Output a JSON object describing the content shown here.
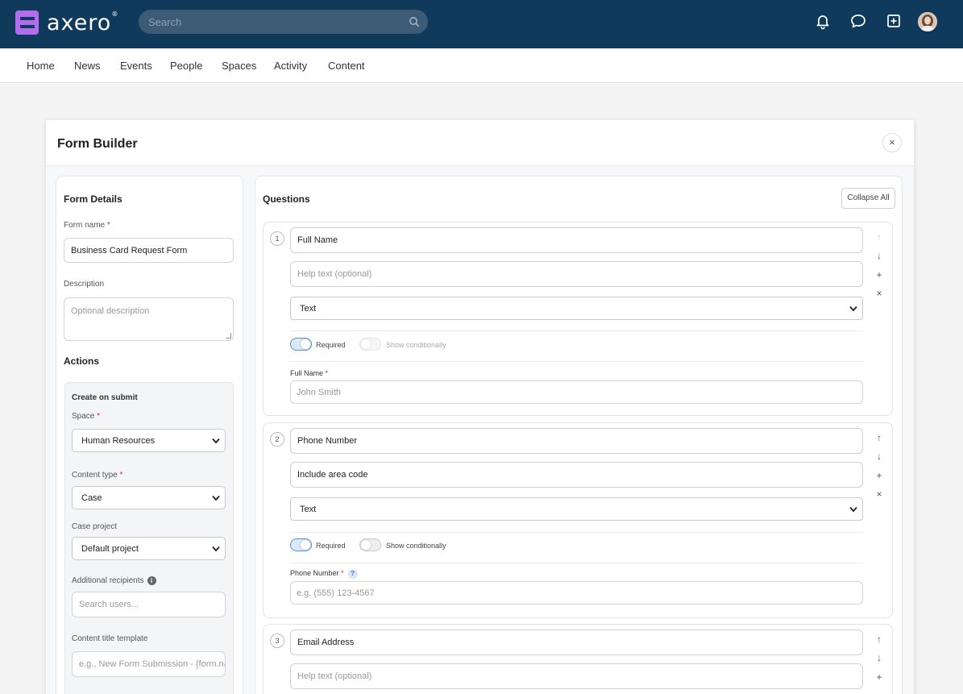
{
  "app": {
    "logo_text": "axero",
    "logo_mark": "®",
    "search_placeholder": "Search"
  },
  "nav": [
    "Home",
    "News",
    "Events",
    "People",
    "Spaces",
    "Activity",
    "Content"
  ],
  "panel": {
    "title": "Form Builder",
    "close_label": "×"
  },
  "form_details": {
    "title": "Form Details",
    "name_label": "Form name",
    "name_required": "*",
    "name_value": "Business Card Request Form",
    "description_label": "Description",
    "description_placeholder": "Optional description"
  },
  "actions": {
    "title": "Actions",
    "create_label": "Create on submit",
    "space_label": "Space",
    "space_value": "Human Resources",
    "content_type_label": "Content type",
    "content_type_value": "Case",
    "case_project_label": "Case project",
    "case_project_value": "Default project",
    "recipients_label": "Additional recipients",
    "recipients_placeholder": "Search users...",
    "title_template_label": "Content title template",
    "title_template_placeholder": "e.g., New Form Submission - {form.na"
  },
  "questions": {
    "title": "Questions",
    "collapse_label": "Collapse All",
    "items": [
      {
        "num": "1",
        "name": "Full Name",
        "help": "Help text (optional)",
        "help_is_placeholder": true,
        "type": "Text",
        "required_label": "Required",
        "conditional_label": "Show conditionally",
        "preview_label": "Full Name",
        "preview_placeholder": "John Smith"
      },
      {
        "num": "2",
        "name": "Phone Number",
        "help": "Include area code",
        "help_is_placeholder": false,
        "type": "Text",
        "required_label": "Required",
        "conditional_label": "Show conditionally",
        "preview_label": "Phone Number",
        "preview_placeholder": "e.g. (555) 123-4567",
        "help_badge": "?"
      },
      {
        "num": "3",
        "name": "Email Address",
        "help": "Help text (optional)",
        "help_is_placeholder": true
      }
    ],
    "side_glyphs": {
      "up": "↑",
      "down": "↓",
      "add": "+",
      "remove": "×"
    }
  },
  "required_mark": "*",
  "info_glyph": "i"
}
